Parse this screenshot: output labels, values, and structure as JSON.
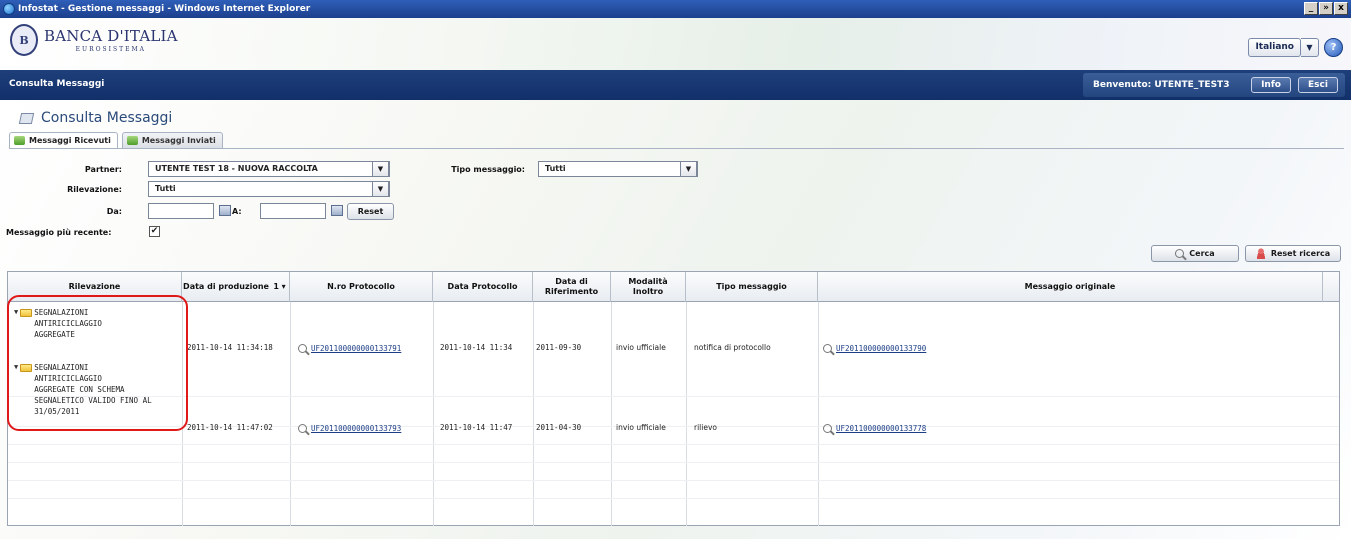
{
  "window": {
    "title": "Infostat - Gestione messaggi - Windows Internet Explorer",
    "controls": [
      "_",
      "»",
      "x"
    ]
  },
  "header": {
    "brand_name": "BANCA D'ITALIA",
    "brand_sub": "EUROSISTEMA",
    "language": "Italiano",
    "help_icon": "question-icon"
  },
  "navbar": {
    "title": "Consulta Messaggi",
    "welcome": "Benvenuto:  UTENTE_TEST3",
    "info_label": "Info",
    "exit_label": "Esci"
  },
  "page": {
    "title": "Consulta Messaggi",
    "tabs": [
      {
        "label": "Messaggi Ricevuti",
        "active": true
      },
      {
        "label": "Messaggi Inviati",
        "active": false
      }
    ]
  },
  "filters": {
    "partner_label": "Partner:",
    "partner_value": "UTENTE TEST 18 - NUOVA RACCOLTA",
    "tipo_label": "Tipo messaggio:",
    "tipo_value": "Tutti",
    "rilevazione_label": "Rilevazione:",
    "rilevazione_value": "Tutti",
    "da_label": "Da:",
    "a_label": "A:",
    "reset_label": "Reset",
    "recent_label": "Messaggio più recente:",
    "recent_checked": "✔",
    "cerca_label": "Cerca",
    "reset_ricerca_label": "Reset ricerca"
  },
  "table": {
    "headers": [
      "Rilevazione",
      "Data di produzione",
      "1 ▾",
      "N.ro Protocollo",
      "Data Protocollo",
      "Data di Riferimento",
      "Modalità Inoltro",
      "Tipo messaggio",
      "Messaggio originale"
    ],
    "rows": [
      {
        "rilevazione": [
          "SEGNALAZIONI",
          "ANTIRICICLAGGIO",
          "AGGREGATE"
        ],
        "data_produzione": "2011-10-14 11:34:18",
        "protocollo": "UF201100000000133791",
        "data_protocollo": "2011-10-14 11:34",
        "data_riferimento": "2011-09-30",
        "modalita": "invio ufficiale",
        "tipo": "notifica di protocollo",
        "originale": "UF201100000000133790"
      },
      {
        "rilevazione": [
          "SEGNALAZIONI",
          "ANTIRICICLAGGIO",
          "AGGREGATE CON SCHEMA",
          "SEGNALETICO VALIDO FINO AL",
          "31/05/2011"
        ],
        "data_produzione": "2011-10-14 11:47:02",
        "protocollo": "UF201100000000133793",
        "data_protocollo": "2011-10-14 11:47",
        "data_riferimento": "2011-04-30",
        "modalita": "invio ufficiale",
        "tipo": "rilievo",
        "originale": "UF201100000000133778"
      }
    ]
  },
  "colors": {
    "nav_blue": "#12306a",
    "link_blue": "#1c3e86",
    "highlight_red": "#e01818"
  }
}
